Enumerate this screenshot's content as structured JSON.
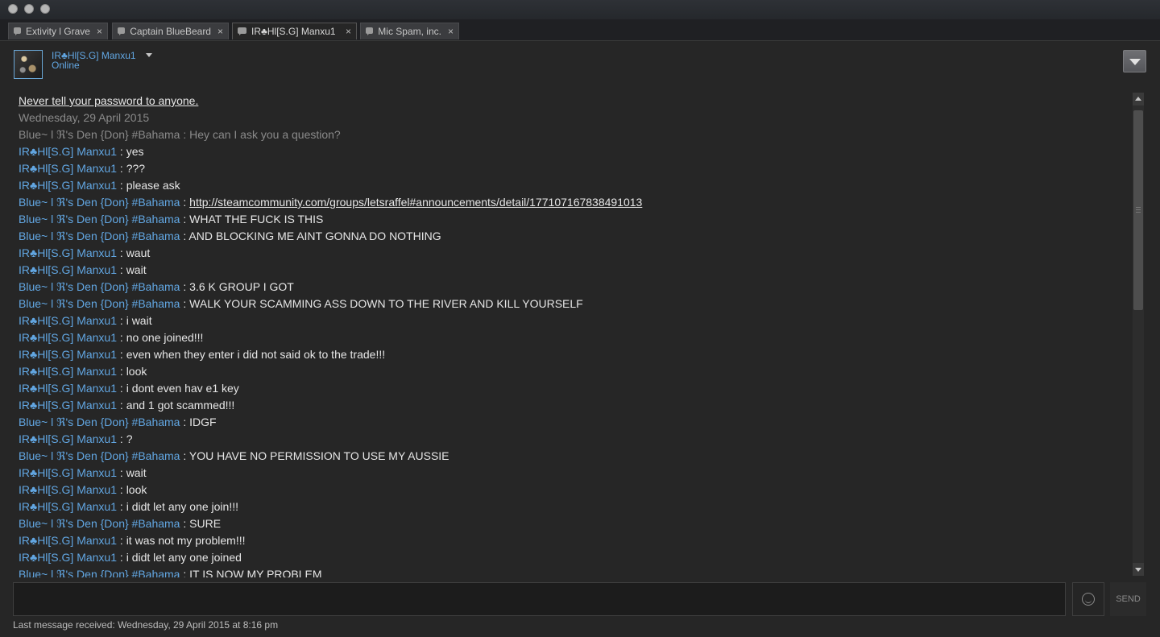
{
  "tabs": [
    {
      "label": "Extivity l Grave",
      "close": "×",
      "active": false
    },
    {
      "label": "Captain BlueBeard",
      "close": "×",
      "active": false
    },
    {
      "label": "IR♣Hl[S.G] Manxu1",
      "close": "×",
      "active": true
    },
    {
      "label": "Mic Spam, inc.",
      "close": "×",
      "active": false
    }
  ],
  "friend": {
    "name": "IR♣Hl[S.G] Manxu1",
    "status": "Online"
  },
  "chat": {
    "warning": "Never tell your password to anyone.",
    "date_header": "Wednesday, 29 April 2015",
    "sep": " : ",
    "messages": [
      {
        "sender": "Blue~ l ℜ's Den {Don} #Bahama",
        "text": "Hey can I ask you a question?",
        "style": "grey"
      },
      {
        "sender": "IR♣Hl[S.G] Manxu1",
        "text": "yes",
        "style": "me"
      },
      {
        "sender": "IR♣Hl[S.G] Manxu1",
        "text": "???",
        "style": "me"
      },
      {
        "sender": "IR♣Hl[S.G] Manxu1",
        "text": "please ask",
        "style": "me"
      },
      {
        "sender": "Blue~ l ℜ's Den {Don} #Bahama",
        "text": "http://steamcommunity.com/groups/letsraffel#announcements/detail/177107167838491013",
        "style": "link"
      },
      {
        "sender": "Blue~ l ℜ's Den {Don} #Bahama",
        "text": "WHAT THE FUCK IS THIS",
        "style": "them"
      },
      {
        "sender": "Blue~ l ℜ's Den {Don} #Bahama",
        "text": "AND BLOCKING ME AINT GONNA DO NOTHING",
        "style": "them"
      },
      {
        "sender": "IR♣Hl[S.G] Manxu1",
        "text": "waut",
        "style": "me"
      },
      {
        "sender": "IR♣Hl[S.G] Manxu1",
        "text": "wait",
        "style": "me"
      },
      {
        "sender": "Blue~ l ℜ's Den {Don} #Bahama",
        "text": "3.6 K GROUP I GOT",
        "style": "them"
      },
      {
        "sender": "Blue~ l ℜ's Den {Don} #Bahama",
        "text": "WALK YOUR SCAMMING ASS DOWN TO THE RIVER AND KILL YOURSELF",
        "style": "them"
      },
      {
        "sender": "IR♣Hl[S.G] Manxu1",
        "text": "i wait",
        "style": "me"
      },
      {
        "sender": "IR♣Hl[S.G] Manxu1",
        "text": "no one joined!!!",
        "style": "me"
      },
      {
        "sender": "IR♣Hl[S.G] Manxu1",
        "text": "even when they enter i did not said ok to the trade!!!",
        "style": "me"
      },
      {
        "sender": "IR♣Hl[S.G] Manxu1",
        "text": "look",
        "style": "me"
      },
      {
        "sender": "IR♣Hl[S.G] Manxu1",
        "text": "i dont even hav e1 key",
        "style": "me"
      },
      {
        "sender": "IR♣Hl[S.G] Manxu1",
        "text": "and 1 got scammed!!!",
        "style": "me"
      },
      {
        "sender": "Blue~ l ℜ's Den {Don} #Bahama",
        "text": "IDGF",
        "style": "them"
      },
      {
        "sender": "IR♣Hl[S.G] Manxu1",
        "text": "?",
        "style": "me"
      },
      {
        "sender": "Blue~ l ℜ's Den {Don} #Bahama",
        "text": "YOU HAVE NO PERMISSION TO USE MY AUSSIE",
        "style": "them"
      },
      {
        "sender": "IR♣Hl[S.G] Manxu1",
        "text": "wait",
        "style": "me"
      },
      {
        "sender": "IR♣Hl[S.G] Manxu1",
        "text": "look",
        "style": "me"
      },
      {
        "sender": "IR♣Hl[S.G] Manxu1",
        "text": "i didt let any one join!!!",
        "style": "me"
      },
      {
        "sender": "Blue~ l ℜ's Den {Don} #Bahama",
        "text": "SURE",
        "style": "them"
      },
      {
        "sender": "IR♣Hl[S.G] Manxu1",
        "text": "it was not my problem!!!",
        "style": "me"
      },
      {
        "sender": "IR♣Hl[S.G] Manxu1",
        "text": "i didt let any one joined",
        "style": "me"
      },
      {
        "sender": "Blue~ l ℜ's Den {Don} #Bahama",
        "text": "IT IS NOW MY PROBLEM",
        "style": "them"
      }
    ]
  },
  "composer": {
    "send_label": "SEND",
    "emoji_icon": "smiley-icon"
  },
  "footer": {
    "last_message": "Last message received: Wednesday, 29 April 2015 at 8:16 pm"
  },
  "colors": {
    "background": "#262626",
    "friend_name": "#62a7e3",
    "grey_text": "#8a8a8a",
    "message_text": "#e6e6e6"
  }
}
